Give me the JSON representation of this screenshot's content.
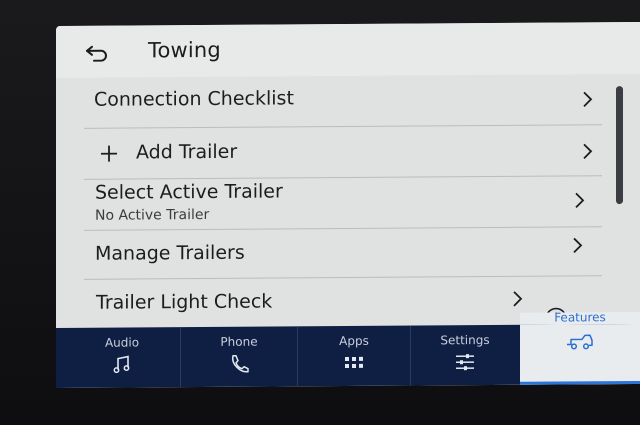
{
  "header": {
    "title": "Towing",
    "back_icon": "back-arrow-icon"
  },
  "list": {
    "items": [
      {
        "label": "Connection Checklist",
        "sublabel": ""
      },
      {
        "label": "Add Trailer",
        "sublabel": "",
        "icon": "plus-icon"
      },
      {
        "label": "Select Active Trailer",
        "sublabel": "No Active Trailer"
      },
      {
        "label": "Manage Trailers",
        "sublabel": ""
      },
      {
        "label": "Trailer Light Check",
        "sublabel": "",
        "extra_icon": "info-icon"
      }
    ]
  },
  "tabs": [
    {
      "label": "Audio",
      "icon": "music-note-icon",
      "active": false
    },
    {
      "label": "Phone",
      "icon": "phone-icon",
      "active": false
    },
    {
      "label": "Apps",
      "icon": "apps-grid-icon",
      "active": false
    },
    {
      "label": "Settings",
      "icon": "sliders-icon",
      "active": false
    },
    {
      "label": "Features",
      "icon": "truck-icon",
      "active": true
    }
  ],
  "colors": {
    "screen_bg": "#e3e6e4",
    "tabbar_bg": "#0f1f44",
    "accent": "#2b6fd0",
    "text": "#1d1d1f"
  }
}
